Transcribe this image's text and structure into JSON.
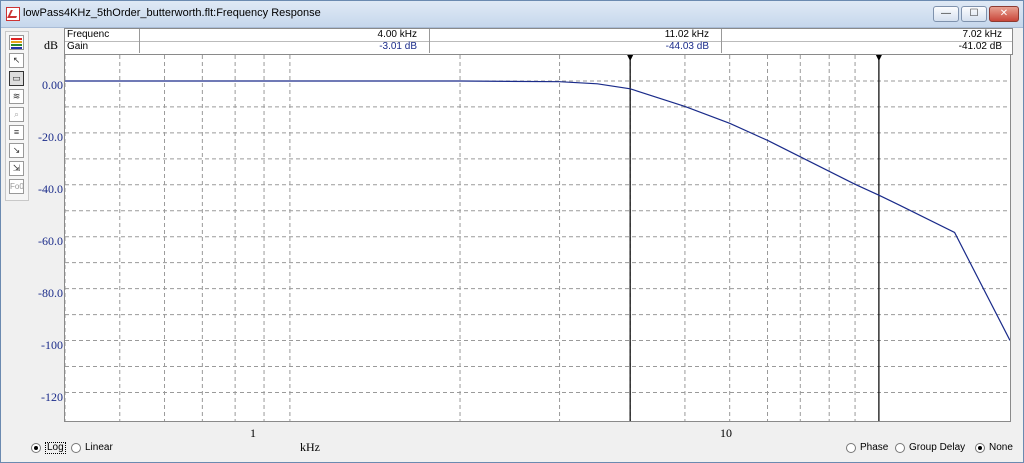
{
  "window": {
    "title": "lowPass4KHz_5thOrder_butterworth.flt:Frequency Response",
    "buttons": {
      "minimize": "—",
      "maximize": "☐",
      "close": "✕"
    }
  },
  "toolbar": {
    "icons": [
      "color-palette-icon",
      "pointer-icon",
      "select-box-icon",
      "waveform-icon",
      "zoom-icon",
      "document-icon",
      "cursor-step-icon",
      "cursor-jump-icon",
      "f0-icon"
    ],
    "f0_label": "Fo0"
  },
  "readout": {
    "rows": [
      {
        "name": "Frequenc",
        "v1": "4.00 kHz",
        "v2": "11.02 kHz",
        "v3": "7.02 kHz"
      },
      {
        "name": "Gain",
        "v1": "-3.01 dB",
        "v2": "-44.03 dB",
        "v3": "-41.02 dB"
      }
    ]
  },
  "axes": {
    "y_unit": "dB",
    "x_unit": "kHz",
    "y_ticks": [
      "0.00",
      "-20.0",
      "-40.0",
      "-60.0",
      "-80.0",
      "-100",
      "-120"
    ],
    "x_ticks": [
      "1",
      "10"
    ]
  },
  "bottom": {
    "scale_options": [
      {
        "label": "Log",
        "selected": true
      },
      {
        "label": "Linear",
        "selected": false
      }
    ],
    "view_options": [
      {
        "label": "Phase",
        "selected": false
      },
      {
        "label": "Group Delay",
        "selected": false
      },
      {
        "label": "None",
        "selected": true
      }
    ]
  },
  "colors": {
    "trace": "#1a2b8a",
    "cursor": "#000000"
  },
  "chart_data": {
    "type": "line",
    "title": "",
    "xlabel": "kHz",
    "ylabel": "dB",
    "x_scale": "log",
    "xlim": [
      0.4,
      18.8
    ],
    "ylim": [
      -131,
      10
    ],
    "grid": true,
    "series": [
      {
        "x": [
          0.4,
          1,
          2,
          3,
          3.5,
          4,
          5,
          6,
          7.02,
          8,
          10,
          11.02,
          12,
          15,
          18.8
        ],
        "y": [
          0,
          0,
          0,
          -0.3,
          -1.1,
          -3.01,
          -9.8,
          -16.3,
          -23.0,
          -29.2,
          -39.8,
          -44.03,
          -47.9,
          -58.4,
          -100.0
        ]
      }
    ],
    "cursors": [
      {
        "x": 4.0,
        "y": -3.01
      },
      {
        "x": 11.02,
        "y": -44.03
      }
    ]
  }
}
